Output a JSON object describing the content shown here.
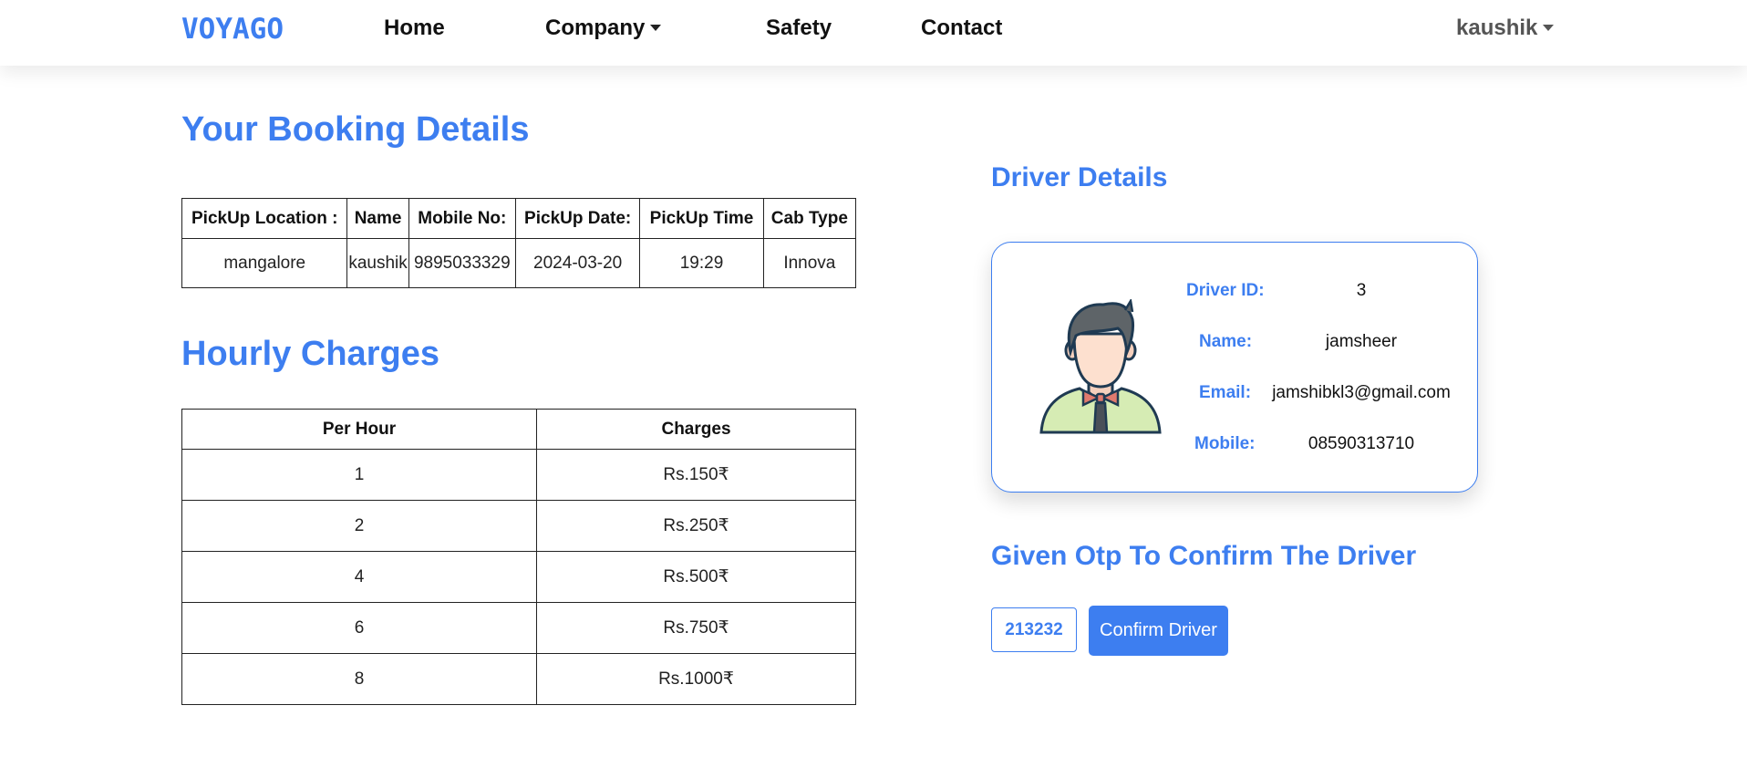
{
  "navbar": {
    "brand": "VOYAGO",
    "links": [
      {
        "label": "Home"
      },
      {
        "label": "Company"
      },
      {
        "label": "Safety"
      },
      {
        "label": "Contact"
      }
    ],
    "user": "kaushik"
  },
  "booking": {
    "title": "Your Booking Details",
    "headers": [
      "PickUp Location :",
      "Name",
      "Mobile No:",
      "PickUp Date:",
      "PickUp Time",
      "Cab Type"
    ],
    "row": [
      "mangalore",
      "kaushik",
      "9895033329",
      "2024-03-20",
      "19:29",
      "Innova"
    ]
  },
  "charges": {
    "title": "Hourly Charges",
    "headers": [
      "Per Hour",
      "Charges"
    ],
    "rows": [
      [
        "1",
        "Rs.150₹"
      ],
      [
        "2",
        "Rs.250₹"
      ],
      [
        "4",
        "Rs.500₹"
      ],
      [
        "6",
        "Rs.750₹"
      ],
      [
        "8",
        "Rs.1000₹"
      ]
    ]
  },
  "driver": {
    "title": "Driver Details",
    "id_label": "Driver ID:",
    "id_value": "3",
    "name_label": "Name:",
    "name_value": "jamsheer",
    "email_label": "Email:",
    "email_value": "jamshibkl3@gmail.com",
    "mobile_label": "Mobile:",
    "mobile_value": "08590313710",
    "avatar_icon": "man-avatar-icon"
  },
  "otp": {
    "title": "Given Otp To Confirm The Driver",
    "code": "213232",
    "button_label": "Confirm Driver"
  },
  "colors": {
    "accent": "#3d7ef0",
    "text": "#111111"
  }
}
